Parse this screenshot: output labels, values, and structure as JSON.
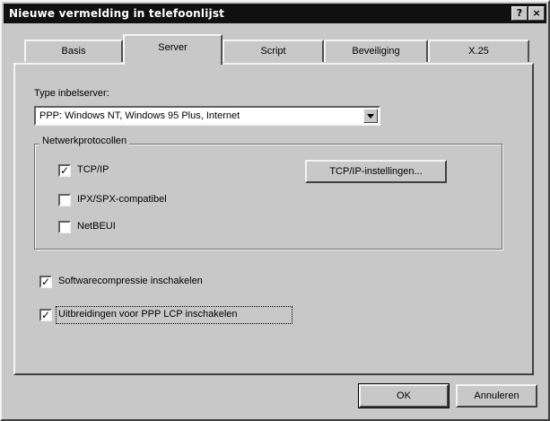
{
  "window": {
    "title": "Nieuwe vermelding in telefoonlijst",
    "help_label": "?",
    "close_label": "×"
  },
  "tabs": [
    "Basis",
    "Server",
    "Script",
    "Beveiliging",
    "X.25"
  ],
  "active_tab": "Server",
  "server": {
    "type_label": "Type inbelserver:",
    "type_value": "PPP: Windows NT, Windows 95 Plus, Internet",
    "network_group_label": "Netwerkprotocollen",
    "protocols": [
      {
        "label": "TCP/IP",
        "checked": true
      },
      {
        "label": "IPX/SPX-compatibel",
        "checked": false
      },
      {
        "label": "NetBEUI",
        "checked": false
      }
    ],
    "tcpip_settings_label": "TCP/IP-instellingen...",
    "options": [
      {
        "label": "Softwarecompressie inschakelen",
        "checked": true
      },
      {
        "label": "Uitbreidingen voor PPP LCP inschakelen",
        "checked": true
      }
    ]
  },
  "footer": {
    "ok_label": "OK",
    "cancel_label": "Annuleren"
  }
}
